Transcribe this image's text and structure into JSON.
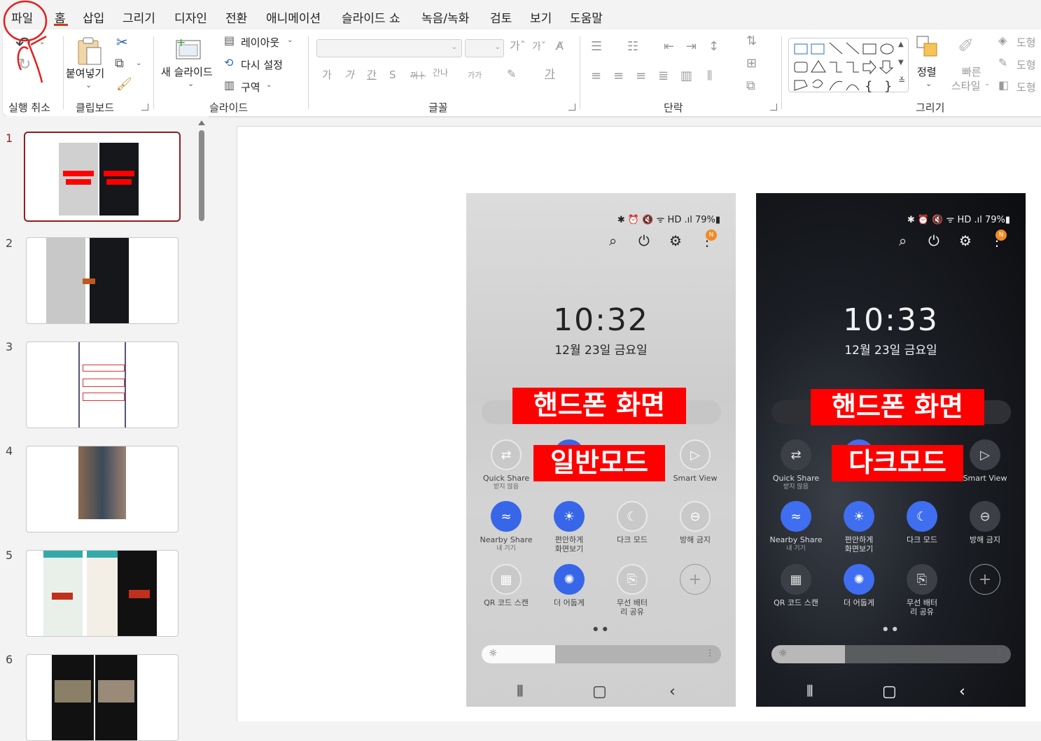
{
  "menu": {
    "items": [
      "파일",
      "홈",
      "삽입",
      "그리기",
      "디자인",
      "전환",
      "애니메이션",
      "슬라이드 쇼",
      "녹음/녹화",
      "검토",
      "보기",
      "도움말"
    ],
    "active": "홈"
  },
  "ribbon": {
    "undo": {
      "label": "실행 취소"
    },
    "clipboard": {
      "label": "클립보드",
      "paste": "붙여넣기"
    },
    "slides": {
      "label": "슬라이드",
      "new_slide": "새 슬라이드",
      "layout": "레이아웃",
      "reset": "다시 설정",
      "section": "구역"
    },
    "font": {
      "label": "글꼴",
      "font_name": "",
      "font_size": ""
    },
    "paragraph": {
      "label": "단락"
    },
    "drawing": {
      "label": "그리기",
      "arrange": "정렬",
      "quick_styles_1": "빠른",
      "quick_styles_2": "스타일",
      "shape_fill": "도형",
      "shape_outline": "도형",
      "shape_effect": "도형"
    }
  },
  "slides": [
    {
      "num": "1"
    },
    {
      "num": "2"
    },
    {
      "num": "3"
    },
    {
      "num": "4"
    },
    {
      "num": "5"
    },
    {
      "num": "6"
    }
  ],
  "phones": {
    "light": {
      "status": "✱ ⏰ 🔇 ᯤ HD .ıl 79%▮",
      "time": "10:32",
      "date": "12월 23일 금요일",
      "label_title": "핸드폰 화면",
      "label_mode": "일반모드"
    },
    "dark": {
      "status": "✱ ⏰ 🔇 ᯤ HD .ıl 79%▮",
      "time": "10:33",
      "date": "12월 23일 금요일",
      "label_title": "핸드폰 화면",
      "label_mode": "다크모드"
    },
    "tiles": {
      "quick_share": "Quick Share",
      "quick_share_sub": "받지 않음",
      "smart_view": "Smart View",
      "nearby_share": "Nearby Share",
      "nearby_share_sub": "내 기기",
      "eye_comfort": "편안하게 화면보기",
      "dark_mode": "다크 모드",
      "dnd": "방해 금지",
      "qr": "QR 코드 스캔",
      "extra_dim": "더 어둡게",
      "wireless_share": "무선 배터리 공유"
    },
    "notif_badge": "N"
  },
  "colors": {
    "accent": "#c43e1c",
    "selected_slide_border": "#8c1f1f",
    "label_red": "#ff0000",
    "tile_blue": "#3866e8"
  }
}
